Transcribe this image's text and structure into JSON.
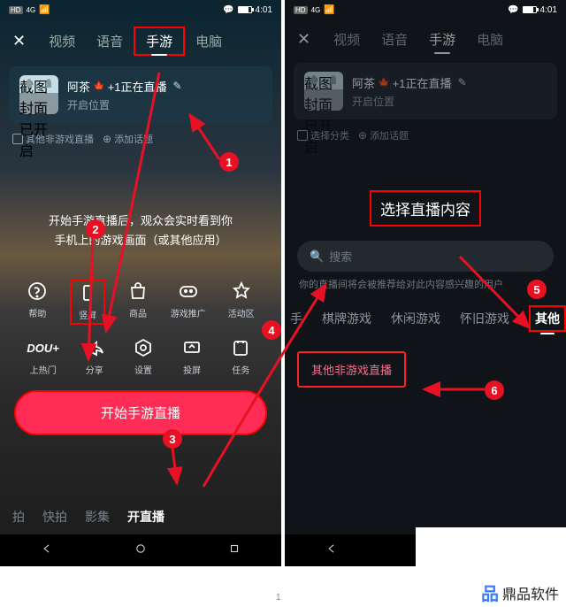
{
  "status": {
    "hd": "HD",
    "net": "4G",
    "time": "4:01"
  },
  "tabs": {
    "t1": "视频",
    "t2": "语音",
    "t3": "手游",
    "t4": "电脑"
  },
  "user": {
    "cover_tag": "截图封面已开启",
    "name_prefix": "阿茶",
    "name_suffix": "+1正在直播",
    "sub": "开启位置"
  },
  "chips": {
    "left1": "其他非游戏直播",
    "left2": "添加话题",
    "right1": "选择分类",
    "right2": "添加话题"
  },
  "desc_l1": "开始手游直播后，观众会实时看到你",
  "desc_l2": "手机上的游戏画面（或其他应用）",
  "grid1": {
    "g1": "帮助",
    "g2": "竖屏",
    "g3": "商品",
    "g4": "游戏推广",
    "g5": "活动区"
  },
  "grid2": {
    "g1": "上热门",
    "g1b": "DOU+",
    "g2": "分享",
    "g3": "设置",
    "g4": "投屏",
    "g5": "任务"
  },
  "start": "开始手游直播",
  "btabs": {
    "b1": "拍",
    "b2": "快拍",
    "b3": "影集",
    "b4": "开直播"
  },
  "right": {
    "title": "选择直播内容",
    "search": "搜索",
    "hint": "你的直播间将会被推荐给对此内容感兴趣的用户",
    "cats": {
      "c0": "手",
      "c1": "棋牌游戏",
      "c2": "休闲游戏",
      "c3": "怀旧游戏",
      "c4": "其他"
    },
    "result": "其他非游戏直播"
  },
  "footnote": "1",
  "logo": "鼎品软件",
  "ann": {
    "a1": "1",
    "a2": "2",
    "a3": "3",
    "a4": "4",
    "a5": "5",
    "a6": "6"
  }
}
